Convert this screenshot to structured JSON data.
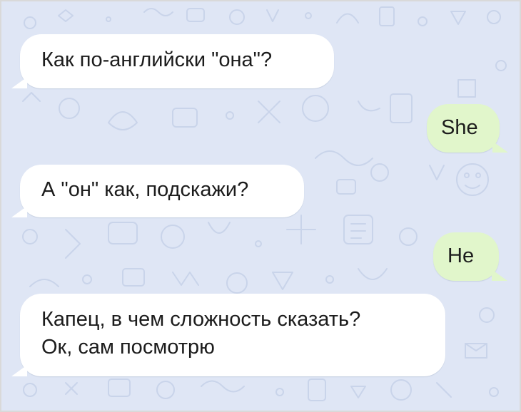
{
  "chat": {
    "background_color": "#dfe6f5",
    "incoming_bubble_color": "#ffffff",
    "outgoing_bubble_color": "#e1f6cb",
    "text_color": "#1c1c1c",
    "messages": [
      {
        "direction": "incoming",
        "lines": [
          "Как по-английски \"она\"?"
        ]
      },
      {
        "direction": "outgoing",
        "lines": [
          "She"
        ]
      },
      {
        "direction": "incoming",
        "lines": [
          "А \"он\" как, подскажи?"
        ]
      },
      {
        "direction": "outgoing",
        "lines": [
          "He"
        ]
      },
      {
        "direction": "incoming",
        "lines": [
          "Капец, в чем сложность сказать?",
          "Ок, сам посмотрю"
        ]
      }
    ]
  }
}
